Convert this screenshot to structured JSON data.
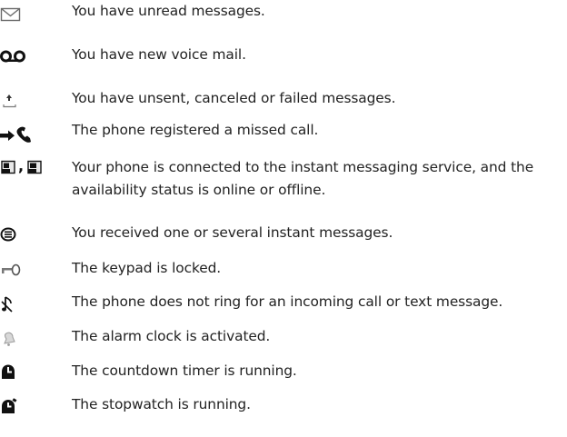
{
  "indicators": [
    {
      "icon": "envelope-icon",
      "lines": [
        "You have unread messages."
      ]
    },
    {
      "icon": "voicemail-icon",
      "lines": [
        "You have new voice mail."
      ]
    },
    {
      "icon": "outbox-upload-icon",
      "lines": [
        "You have unsent, canceled or failed messages."
      ]
    },
    {
      "icon": "missed-call-icon",
      "lines": [
        "The phone registered a missed call."
      ]
    },
    {
      "icon": "instant-messaging-status-icon",
      "prefix_separator": ",",
      "lines": [
        "Your phone is connected to the instant messaging service, and the",
        "availability status is online or offline."
      ]
    },
    {
      "icon": "instant-message-received-icon",
      "lines": [
        "You received one or several instant messages."
      ]
    },
    {
      "icon": "key-lock-icon",
      "lines": [
        "The keypad is locked."
      ]
    },
    {
      "icon": "silent-ring-icon",
      "lines": [
        "The phone does not ring for an incoming call or text message."
      ]
    },
    {
      "icon": "alarm-bell-icon",
      "lines": [
        "The alarm clock is activated."
      ]
    },
    {
      "icon": "countdown-timer-icon",
      "lines": [
        "The countdown timer is running."
      ]
    },
    {
      "icon": "stopwatch-icon",
      "lines": [
        "The stopwatch is running."
      ]
    }
  ]
}
